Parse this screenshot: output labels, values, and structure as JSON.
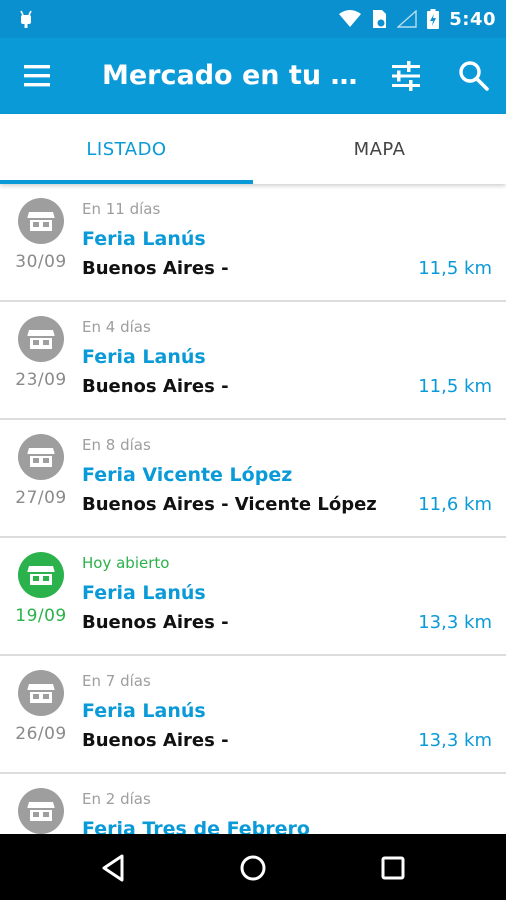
{
  "colors": {
    "primary": "#0b9ad8",
    "open_green": "#2bb24c",
    "closed_gray": "#9e9e9e"
  },
  "status_bar": {
    "time": "5:40"
  },
  "toolbar": {
    "title": "Mercado en tu barrio"
  },
  "tabs": [
    {
      "label": "LISTADO",
      "active": true
    },
    {
      "label": "MAPA",
      "active": false
    }
  ],
  "list": [
    {
      "status": "En 11 días",
      "name": "Feria Lanús",
      "date": "30/09",
      "location": "Buenos Aires -",
      "distance": "11,5 km",
      "open": false
    },
    {
      "status": "En 4 días",
      "name": "Feria Lanús",
      "date": "23/09",
      "location": "Buenos Aires -",
      "distance": "11,5 km",
      "open": false
    },
    {
      "status": "En 8 días",
      "name": "Feria Vicente López",
      "date": "27/09",
      "location": "Buenos Aires - Vicente López",
      "distance": "11,6 km",
      "open": false
    },
    {
      "status": "Hoy abierto",
      "name": "Feria Lanús",
      "date": "19/09",
      "location": "Buenos Aires -",
      "distance": "13,3 km",
      "open": true
    },
    {
      "status": "En 7 días",
      "name": "Feria Lanús",
      "date": "26/09",
      "location": "Buenos Aires -",
      "distance": "13,3 km",
      "open": false
    },
    {
      "status": "En 2 días",
      "name": "Feria Tres de Febrero",
      "date": "",
      "location": "",
      "distance": "",
      "open": false
    }
  ]
}
